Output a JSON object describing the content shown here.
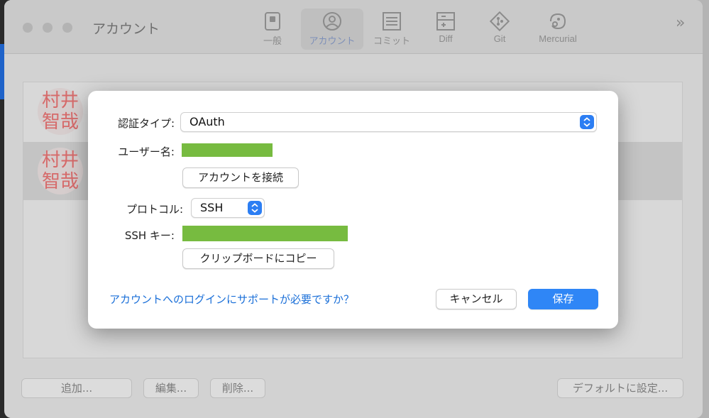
{
  "window": {
    "title": "アカウント",
    "toolbar": [
      {
        "label": "一般",
        "icon": "general-icon"
      },
      {
        "label": "アカウント",
        "icon": "account-icon"
      },
      {
        "label": "コミット",
        "icon": "commit-icon"
      },
      {
        "label": "Diff",
        "icon": "diff-icon"
      },
      {
        "label": "Git",
        "icon": "git-icon"
      },
      {
        "label": "Mercurial",
        "icon": "mercurial-icon"
      }
    ],
    "more_label": "»"
  },
  "accounts": [
    {
      "avatar_text_1": "村井",
      "avatar_text_2": "智哉"
    },
    {
      "avatar_text_1": "村井",
      "avatar_text_2": "智哉"
    }
  ],
  "bottom_buttons": {
    "add": "追加...",
    "edit": "編集...",
    "delete": "削除...",
    "set_default": "デフォルトに設定..."
  },
  "dialog": {
    "auth_type_label": "認証タイプ:",
    "auth_type_value": "OAuth",
    "username_label": "ユーザー名:",
    "connect_button": "アカウントを接続",
    "protocol_label": "プロトコル:",
    "protocol_value": "SSH",
    "ssh_key_label": "SSH キー:",
    "copy_button": "クリップボードにコピー",
    "help_link": "アカウントへのログインにサポートが必要ですか？",
    "cancel_button": "キャンセル",
    "save_button": "保存"
  },
  "colors": {
    "accent": "#2f86f6",
    "redacted": "#77bb40",
    "link": "#1a6fd8"
  }
}
